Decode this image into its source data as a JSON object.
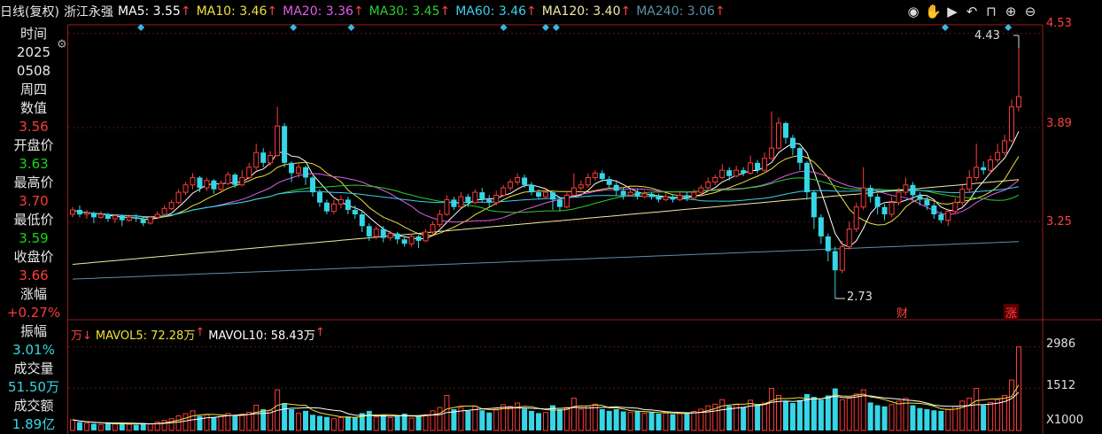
{
  "header": {
    "period": "日线(复权)",
    "stock_name": "浙江永强",
    "ma": [
      {
        "label": "MA5: 3.55",
        "arrow": "↑",
        "color": "#ffffff"
      },
      {
        "label": "MA10: 3.46",
        "arrow": "↑",
        "color": "#f0e03c"
      },
      {
        "label": "MA20: 3.36",
        "arrow": "↑",
        "color": "#e15ce8"
      },
      {
        "label": "MA30: 3.45",
        "arrow": "↑",
        "color": "#2ad02a"
      },
      {
        "label": "MA60: 3.46",
        "arrow": "↑",
        "color": "#3ad0f0"
      },
      {
        "label": "MA120: 3.40",
        "arrow": "↑",
        "color": "#f3e9a8"
      },
      {
        "label": "MA240: 3.06",
        "arrow": "↑",
        "color": "#5b8fa8"
      }
    ],
    "tools": [
      "eye-icon",
      "hand-icon",
      "play-icon",
      "undo-icon",
      "lock-icon",
      "zoom-in-icon",
      "zoom-out-icon"
    ]
  },
  "info_panel": {
    "time_label": "时间",
    "year": "2025",
    "date": "0508",
    "weekday": "周四",
    "value_label": "数值",
    "value": "3.56",
    "open_label": "开盘价",
    "open": "3.63",
    "high_label": "最高价",
    "high": "3.70",
    "low_label": "最低价",
    "low": "3.59",
    "close_label": "收盘价",
    "close": "3.66",
    "change_label": "涨幅",
    "change": "+0.27%",
    "amplitude_label": "振幅",
    "amplitude": "3.01%",
    "volume_label": "成交量",
    "volume": "51.50万",
    "turnover_label": "成交额",
    "turnover": "1.89亿"
  },
  "price_axis": {
    "ticks": [
      "4.53",
      "3.89",
      "3.25"
    ]
  },
  "volume_axis": {
    "ticks": [
      "2986",
      "1512"
    ],
    "unit": "X1000"
  },
  "annotations": {
    "high_marker": "4.43",
    "low_marker": "2.73",
    "tag_finance": "财",
    "tag_limit_up": "涨"
  },
  "volume_legend": {
    "prefix": "万↓",
    "mavol5": "MAVOL5: 72.28万",
    "mavol10": "MAVOL10: 58.43万",
    "arrow": "↑"
  },
  "colors": {
    "up": "#ff3b3b",
    "down": "#35d6e6",
    "bg": "#000000",
    "separator": "#9a1c1c"
  },
  "chart_data": {
    "type": "candlestick",
    "price_ylim": [
      2.65,
      4.6
    ],
    "candles": [
      [
        3.3,
        3.33,
        3.35,
        3.28
      ],
      [
        3.33,
        3.3,
        3.36,
        3.28
      ],
      [
        3.3,
        3.31,
        3.33,
        3.27
      ],
      [
        3.31,
        3.28,
        3.32,
        3.24
      ],
      [
        3.28,
        3.3,
        3.32,
        3.27
      ],
      [
        3.3,
        3.27,
        3.31,
        3.25
      ],
      [
        3.27,
        3.29,
        3.3,
        3.24
      ],
      [
        3.29,
        3.26,
        3.3,
        3.22
      ],
      [
        3.26,
        3.28,
        3.3,
        3.25
      ],
      [
        3.28,
        3.27,
        3.3,
        3.25
      ],
      [
        3.27,
        3.24,
        3.28,
        3.22
      ],
      [
        3.24,
        3.28,
        3.29,
        3.23
      ],
      [
        3.28,
        3.3,
        3.32,
        3.27
      ],
      [
        3.3,
        3.34,
        3.36,
        3.29
      ],
      [
        3.34,
        3.38,
        3.4,
        3.33
      ],
      [
        3.38,
        3.45,
        3.47,
        3.37
      ],
      [
        3.45,
        3.5,
        3.52,
        3.43
      ],
      [
        3.5,
        3.55,
        3.58,
        3.47
      ],
      [
        3.55,
        3.48,
        3.56,
        3.45
      ],
      [
        3.48,
        3.53,
        3.55,
        3.46
      ],
      [
        3.53,
        3.47,
        3.54,
        3.44
      ],
      [
        3.47,
        3.51,
        3.53,
        3.45
      ],
      [
        3.51,
        3.57,
        3.59,
        3.5
      ],
      [
        3.57,
        3.5,
        3.58,
        3.48
      ],
      [
        3.5,
        3.55,
        3.6,
        3.49
      ],
      [
        3.55,
        3.62,
        3.65,
        3.54
      ],
      [
        3.62,
        3.72,
        3.78,
        3.6
      ],
      [
        3.72,
        3.65,
        3.75,
        3.62
      ],
      [
        3.65,
        3.7,
        3.73,
        3.63
      ],
      [
        3.7,
        3.9,
        4.03,
        3.69
      ],
      [
        3.9,
        3.65,
        3.92,
        3.62
      ],
      [
        3.65,
        3.58,
        3.66,
        3.52
      ],
      [
        3.58,
        3.62,
        3.64,
        3.55
      ],
      [
        3.62,
        3.55,
        3.63,
        3.5
      ],
      [
        3.55,
        3.45,
        3.56,
        3.42
      ],
      [
        3.45,
        3.38,
        3.47,
        3.35
      ],
      [
        3.38,
        3.32,
        3.4,
        3.3
      ],
      [
        3.32,
        3.37,
        3.4,
        3.3
      ],
      [
        3.37,
        3.4,
        3.43,
        3.34
      ],
      [
        3.4,
        3.33,
        3.42,
        3.3
      ],
      [
        3.33,
        3.3,
        3.36,
        3.27
      ],
      [
        3.3,
        3.22,
        3.32,
        3.18
      ],
      [
        3.22,
        3.15,
        3.24,
        3.12
      ],
      [
        3.15,
        3.2,
        3.22,
        3.13
      ],
      [
        3.2,
        3.14,
        3.22,
        3.11
      ],
      [
        3.14,
        3.17,
        3.19,
        3.12
      ],
      [
        3.17,
        3.13,
        3.18,
        3.1
      ],
      [
        3.13,
        3.1,
        3.15,
        3.08
      ],
      [
        3.1,
        3.15,
        3.17,
        3.08
      ],
      [
        3.15,
        3.12,
        3.16,
        3.07
      ],
      [
        3.12,
        3.18,
        3.2,
        3.11
      ],
      [
        3.18,
        3.23,
        3.25,
        3.16
      ],
      [
        3.23,
        3.3,
        3.33,
        3.21
      ],
      [
        3.3,
        3.4,
        3.43,
        3.29
      ],
      [
        3.4,
        3.35,
        3.42,
        3.33
      ],
      [
        3.35,
        3.42,
        3.45,
        3.34
      ],
      [
        3.42,
        3.38,
        3.44,
        3.35
      ],
      [
        3.38,
        3.45,
        3.47,
        3.37
      ],
      [
        3.45,
        3.4,
        3.48,
        3.38
      ],
      [
        3.4,
        3.38,
        3.43,
        3.35
      ],
      [
        3.38,
        3.43,
        3.46,
        3.36
      ],
      [
        3.43,
        3.48,
        3.5,
        3.42
      ],
      [
        3.48,
        3.52,
        3.54,
        3.46
      ],
      [
        3.52,
        3.55,
        3.58,
        3.5
      ],
      [
        3.55,
        3.5,
        3.57,
        3.48
      ],
      [
        3.5,
        3.45,
        3.52,
        3.43
      ],
      [
        3.45,
        3.42,
        3.47,
        3.4
      ],
      [
        3.42,
        3.45,
        3.47,
        3.41
      ],
      [
        3.45,
        3.4,
        3.46,
        3.33
      ],
      [
        3.4,
        3.35,
        3.42,
        3.32
      ],
      [
        3.35,
        3.43,
        3.46,
        3.34
      ],
      [
        3.43,
        3.48,
        3.58,
        3.42
      ],
      [
        3.48,
        3.5,
        3.53,
        3.46
      ],
      [
        3.5,
        3.55,
        3.58,
        3.48
      ],
      [
        3.55,
        3.58,
        3.6,
        3.53
      ],
      [
        3.58,
        3.54,
        3.6,
        3.52
      ],
      [
        3.54,
        3.5,
        3.56,
        3.48
      ],
      [
        3.5,
        3.46,
        3.52,
        3.43
      ],
      [
        3.46,
        3.43,
        3.48,
        3.4
      ],
      [
        3.43,
        3.45,
        3.47,
        3.42
      ],
      [
        3.45,
        3.42,
        3.47,
        3.4
      ],
      [
        3.42,
        3.44,
        3.46,
        3.41
      ],
      [
        3.44,
        3.42,
        3.45,
        3.4
      ],
      [
        3.42,
        3.4,
        3.44,
        3.38
      ],
      [
        3.4,
        3.42,
        3.44,
        3.39
      ],
      [
        3.42,
        3.4,
        3.43,
        3.38
      ],
      [
        3.4,
        3.43,
        3.45,
        3.39
      ],
      [
        3.43,
        3.41,
        3.45,
        3.39
      ],
      [
        3.41,
        3.45,
        3.47,
        3.4
      ],
      [
        3.45,
        3.48,
        3.5,
        3.43
      ],
      [
        3.48,
        3.52,
        3.55,
        3.47
      ],
      [
        3.52,
        3.55,
        3.57,
        3.5
      ],
      [
        3.55,
        3.6,
        3.64,
        3.54
      ],
      [
        3.6,
        3.56,
        3.62,
        3.53
      ],
      [
        3.56,
        3.6,
        3.63,
        3.55
      ],
      [
        3.6,
        3.58,
        3.62,
        3.56
      ],
      [
        3.58,
        3.65,
        3.7,
        3.57
      ],
      [
        3.65,
        3.6,
        3.67,
        3.58
      ],
      [
        3.6,
        3.68,
        3.72,
        3.59
      ],
      [
        3.68,
        3.75,
        4.0,
        3.67
      ],
      [
        3.75,
        3.92,
        3.96,
        3.74
      ],
      [
        3.92,
        3.82,
        3.93,
        3.78
      ],
      [
        3.82,
        3.75,
        3.84,
        3.7
      ],
      [
        3.75,
        3.65,
        3.76,
        3.6
      ],
      [
        3.65,
        3.45,
        3.66,
        3.4
      ],
      [
        3.45,
        3.28,
        3.46,
        3.2
      ],
      [
        3.28,
        3.15,
        3.3,
        3.1
      ],
      [
        3.15,
        3.05,
        3.17,
        2.98
      ],
      [
        3.05,
        2.92,
        3.08,
        2.73
      ],
      [
        2.92,
        3.08,
        3.12,
        2.9
      ],
      [
        3.08,
        3.2,
        3.25,
        3.06
      ],
      [
        3.2,
        3.35,
        3.38,
        3.18
      ],
      [
        3.35,
        3.48,
        3.62,
        3.33
      ],
      [
        3.48,
        3.42,
        3.5,
        3.38
      ],
      [
        3.42,
        3.35,
        3.44,
        3.3
      ],
      [
        3.35,
        3.3,
        3.37,
        3.26
      ],
      [
        3.3,
        3.38,
        3.42,
        3.28
      ],
      [
        3.38,
        3.45,
        3.48,
        3.36
      ],
      [
        3.45,
        3.5,
        3.55,
        3.43
      ],
      [
        3.5,
        3.43,
        3.52,
        3.4
      ],
      [
        3.43,
        3.4,
        3.45,
        3.36
      ],
      [
        3.4,
        3.36,
        3.42,
        3.33
      ],
      [
        3.36,
        3.3,
        3.38,
        3.27
      ],
      [
        3.3,
        3.26,
        3.32,
        3.24
      ],
      [
        3.26,
        3.32,
        3.34,
        3.22
      ],
      [
        3.32,
        3.38,
        3.41,
        3.3
      ],
      [
        3.38,
        3.47,
        3.5,
        3.36
      ],
      [
        3.47,
        3.55,
        3.6,
        3.45
      ],
      [
        3.55,
        3.62,
        3.78,
        3.53
      ],
      [
        3.62,
        3.6,
        3.66,
        3.57
      ],
      [
        3.6,
        3.67,
        3.7,
        3.58
      ],
      [
        3.67,
        3.72,
        3.78,
        3.65
      ],
      [
        3.72,
        3.8,
        3.84,
        3.7
      ],
      [
        3.8,
        4.03,
        4.08,
        3.79
      ],
      [
        4.03,
        4.1,
        4.43,
        4.0
      ]
    ],
    "volume_ylim": [
      0,
      3100
    ],
    "volumes": [
      380,
      300,
      260,
      240,
      210,
      250,
      230,
      260,
      220,
      200,
      270,
      230,
      300,
      360,
      420,
      520,
      600,
      700,
      520,
      560,
      480,
      500,
      610,
      520,
      580,
      650,
      900,
      760,
      720,
      1450,
      980,
      760,
      620,
      700,
      560,
      520,
      480,
      420,
      460,
      500,
      460,
      620,
      700,
      480,
      560,
      460,
      500,
      600,
      440,
      520,
      560,
      700,
      820,
      1250,
      760,
      820,
      700,
      860,
      720,
      640,
      760,
      920,
      860,
      980,
      780,
      700,
      620,
      640,
      900,
      760,
      820,
      1150,
      760,
      880,
      940,
      760,
      700,
      760,
      680,
      640,
      680,
      620,
      660,
      600,
      620,
      580,
      600,
      640,
      680,
      760,
      880,
      940,
      1100,
      880,
      920,
      840,
      1080,
      900,
      980,
      1500,
      1250,
      1050,
      980,
      1080,
      1300,
      1200,
      1100,
      1250,
      1500,
      1100,
      1150,
      1300,
      1450,
      1000,
      900,
      860,
      920,
      1050,
      1150,
      900,
      800,
      760,
      720,
      700,
      760,
      860,
      1050,
      1150,
      1500,
      900,
      1000,
      1100,
      1250,
      1800,
      2986
    ]
  }
}
